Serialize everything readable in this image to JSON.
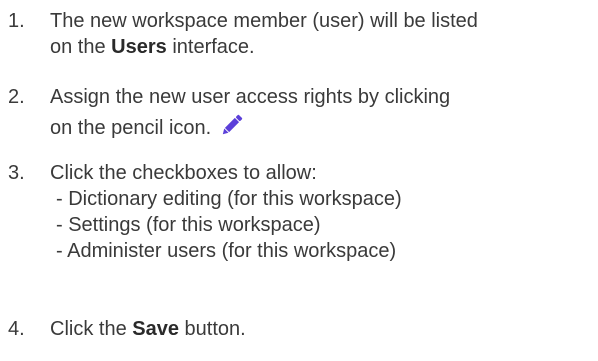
{
  "icons": {
    "pencil": "pencil-icon"
  },
  "colors": {
    "text": "#3a3a3a",
    "pencil_accent": "#5b3fd9"
  },
  "steps": [
    {
      "number": "1.",
      "line1": "The new workspace member (user) will be listed",
      "line2_pre": "on the ",
      "line2_bold": "Users",
      "line2_post": " interface."
    },
    {
      "number": "2.",
      "line1": "Assign the new user access rights by clicking",
      "line2": "on the pencil icon."
    },
    {
      "number": "3.",
      "line1": "Click the checkboxes to allow:",
      "items": [
        "- Dictionary editing (for this workspace)",
        "- Settings (for this workspace)",
        "- Administer users (for this workspace)"
      ]
    },
    {
      "number": "4.",
      "line_pre": "Click the ",
      "line_bold": "Save",
      "line_post": " button."
    }
  ]
}
